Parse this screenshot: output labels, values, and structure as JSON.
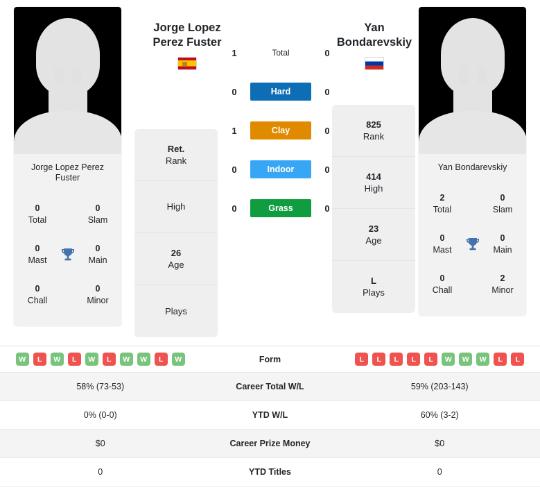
{
  "players": {
    "left": {
      "display_name_line1": "Jorge Lopez",
      "display_name_line2": "Perez Fuster",
      "card_name": "Jorge Lopez Perez Fuster",
      "flag": "flag-es",
      "avatar": "player-silhouette-placeholder",
      "titles": {
        "total": "0",
        "total_label": "Total",
        "slam": "0",
        "slam_label": "Slam",
        "mast": "0",
        "mast_label": "Mast",
        "main": "0",
        "main_label": "Main",
        "chall": "0",
        "chall_label": "Chall",
        "minor": "0",
        "minor_label": "Minor"
      },
      "info": [
        {
          "value": "Ret.",
          "label": "Rank"
        },
        {
          "value": "",
          "label": "High"
        },
        {
          "value": "26",
          "label": "Age"
        },
        {
          "value": "",
          "label": "Plays"
        }
      ],
      "form": [
        "W",
        "L",
        "W",
        "L",
        "W",
        "L",
        "W",
        "W",
        "L",
        "W"
      ],
      "career_total_wl": "58% (73-53)",
      "ytd_wl": "0% (0-0)",
      "career_prize_money": "$0",
      "ytd_titles": "0"
    },
    "right": {
      "display_name_line1": "Yan",
      "display_name_line2": "Bondarevskiy",
      "card_name": "Yan Bondarevskiy",
      "flag": "flag-ru",
      "avatar": "player-silhouette-placeholder",
      "titles": {
        "total": "2",
        "total_label": "Total",
        "slam": "0",
        "slam_label": "Slam",
        "mast": "0",
        "mast_label": "Mast",
        "main": "0",
        "main_label": "Main",
        "chall": "0",
        "chall_label": "Chall",
        "minor": "2",
        "minor_label": "Minor"
      },
      "info": [
        {
          "value": "825",
          "label": "Rank"
        },
        {
          "value": "414",
          "label": "High"
        },
        {
          "value": "23",
          "label": "Age"
        },
        {
          "value": "L",
          "label": "Plays"
        }
      ],
      "form": [
        "L",
        "L",
        "L",
        "L",
        "L",
        "W",
        "W",
        "W",
        "L",
        "L"
      ],
      "career_total_wl": "59% (203-143)",
      "ytd_wl": "60% (3-2)",
      "career_prize_money": "$0",
      "ytd_titles": "0"
    }
  },
  "head_to_head": {
    "rows": [
      {
        "left": "1",
        "label": "Total",
        "right": "0",
        "color": "",
        "style": "plain"
      },
      {
        "left": "0",
        "label": "Hard",
        "right": "0",
        "color": "#0d6db5",
        "style": "chip"
      },
      {
        "left": "1",
        "label": "Clay",
        "right": "0",
        "color": "#e08a00",
        "style": "chip"
      },
      {
        "left": "0",
        "label": "Indoor",
        "right": "0",
        "color": "#37a7f5",
        "style": "chip"
      },
      {
        "left": "0",
        "label": "Grass",
        "right": "0",
        "color": "#0f9d3f",
        "style": "chip"
      }
    ]
  },
  "stats_table": {
    "rows": [
      {
        "label": "Form",
        "left": "",
        "right": "",
        "type": "form"
      },
      {
        "label": "Career Total W/L",
        "left": "58% (73-53)",
        "right": "59% (203-143)",
        "type": "text"
      },
      {
        "label": "YTD W/L",
        "left": "0% (0-0)",
        "right": "60% (3-2)",
        "type": "text"
      },
      {
        "label": "Career Prize Money",
        "left": "$0",
        "right": "$0",
        "type": "text"
      },
      {
        "label": "YTD Titles",
        "left": "0",
        "right": "0",
        "type": "text"
      }
    ]
  },
  "colors": {
    "win": "#79c47c",
    "loss": "#ef5350",
    "hard": "#0d6db5",
    "clay": "#e08a00",
    "indoor": "#37a7f5",
    "grass": "#0f9d3f",
    "trophy": "#4472ab"
  }
}
